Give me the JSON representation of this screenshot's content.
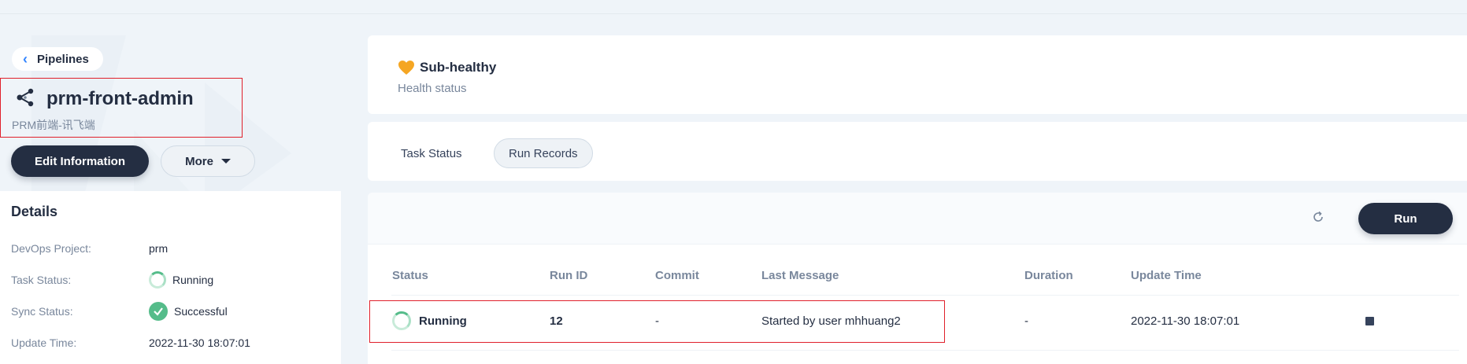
{
  "nav": {
    "back_label": "Pipelines"
  },
  "pipeline": {
    "name": "prm-front-admin",
    "description": "PRM前端-讯飞端"
  },
  "actions": {
    "edit_label": "Edit Information",
    "more_label": "More"
  },
  "details": {
    "title": "Details",
    "rows": [
      {
        "label": "DevOps Project:",
        "value": "prm"
      },
      {
        "label": "Task Status:",
        "value": "Running"
      },
      {
        "label": "Sync Status:",
        "value": "Successful"
      },
      {
        "label": "Update Time:",
        "value": "2022-11-30 18:07:01"
      }
    ]
  },
  "health": {
    "status": "Sub-healthy",
    "subtitle": "Health status",
    "color": "#f5a623"
  },
  "tabs": [
    {
      "label": "Task Status",
      "active": false
    },
    {
      "label": "Run Records",
      "active": true
    }
  ],
  "toolbar": {
    "run_label": "Run"
  },
  "table": {
    "columns": [
      "Status",
      "Run ID",
      "Commit",
      "Last Message",
      "Duration",
      "Update Time"
    ],
    "rows": [
      {
        "status": "Running",
        "run_id": "12",
        "commit": "-",
        "last_message": "Started by user mhhuang2",
        "duration": "-",
        "update_time": "2022-11-30 18:07:01"
      }
    ]
  },
  "colors": {
    "primary_dark": "#242e42",
    "success": "#55bc8a",
    "highlight_border": "#e0202b"
  }
}
